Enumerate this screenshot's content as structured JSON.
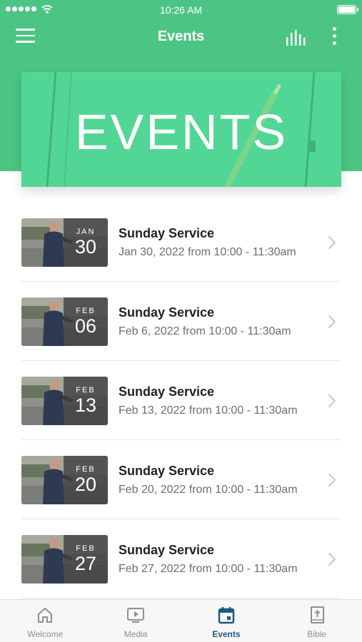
{
  "status_bar": {
    "time": "10:26 AM"
  },
  "nav": {
    "title": "Events"
  },
  "banner": {
    "text": "EVENTS"
  },
  "events": [
    {
      "month": "JAN",
      "day": "30",
      "title": "Sunday Service",
      "subtitle": "Jan 30, 2022 from 10:00 - 11:30am"
    },
    {
      "month": "FEB",
      "day": "06",
      "title": "Sunday Service",
      "subtitle": "Feb 6, 2022 from 10:00 - 11:30am"
    },
    {
      "month": "FEB",
      "day": "13",
      "title": "Sunday Service",
      "subtitle": "Feb 13, 2022 from 10:00 - 11:30am"
    },
    {
      "month": "FEB",
      "day": "20",
      "title": "Sunday Service",
      "subtitle": "Feb 20, 2022 from 10:00 - 11:30am"
    },
    {
      "month": "FEB",
      "day": "27",
      "title": "Sunday Service",
      "subtitle": "Feb 27, 2022 from 10:00 - 11:30am"
    }
  ],
  "tabs": [
    {
      "label": "Welcome",
      "icon": "home-icon"
    },
    {
      "label": "Media",
      "icon": "media-icon"
    },
    {
      "label": "Events",
      "icon": "calendar-icon",
      "active": true
    },
    {
      "label": "Bible",
      "icon": "bible-icon"
    }
  ],
  "colors": {
    "brand": "#4cc584",
    "banner": "#52d695",
    "active_tab": "#1f5a7a"
  }
}
